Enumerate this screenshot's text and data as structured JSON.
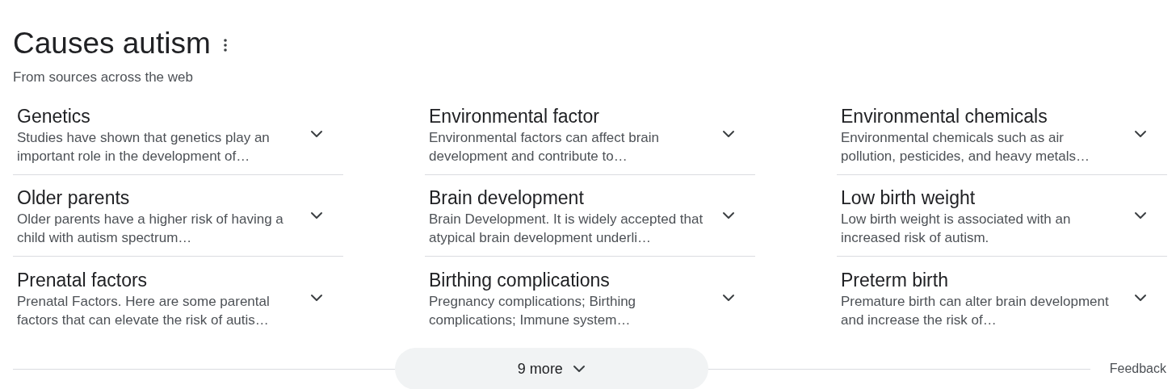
{
  "header": {
    "title": "Causes autism",
    "subtitle": "From sources across the web"
  },
  "items": [
    {
      "title": "Genetics",
      "description": "Studies have shown that genetics play an important role in the development of…",
      "expanded": false
    },
    {
      "title": "Environmental factor",
      "description": "Environmental factors can affect brain development and contribute to…",
      "expanded": false
    },
    {
      "title": "Environmental chemicals",
      "description": "Environmental chemicals such as air pollution, pesticides, and heavy metals…",
      "expanded": false
    },
    {
      "title": "Older parents",
      "description": "Older parents have a higher risk of having a child with autism spectrum…",
      "expanded": false
    },
    {
      "title": "Brain development",
      "description": "Brain Development. It is widely accepted that atypical brain development underli…",
      "expanded": false
    },
    {
      "title": "Low birth weight",
      "description": "Low birth weight is associated with an increased risk of autism.",
      "expanded": false
    },
    {
      "title": "Prenatal factors",
      "description": "Prenatal Factors. Here are some parental factors that can elevate the risk of autis…",
      "expanded": false
    },
    {
      "title": "Birthing complications",
      "description": "Pregnancy complications; Birthing complications; Immune system…",
      "expanded": false
    },
    {
      "title": "Preterm birth",
      "description": "Premature birth can alter brain development and increase the risk of…",
      "expanded": false
    }
  ],
  "more_button": "9 more",
  "feedback": "Feedback"
}
